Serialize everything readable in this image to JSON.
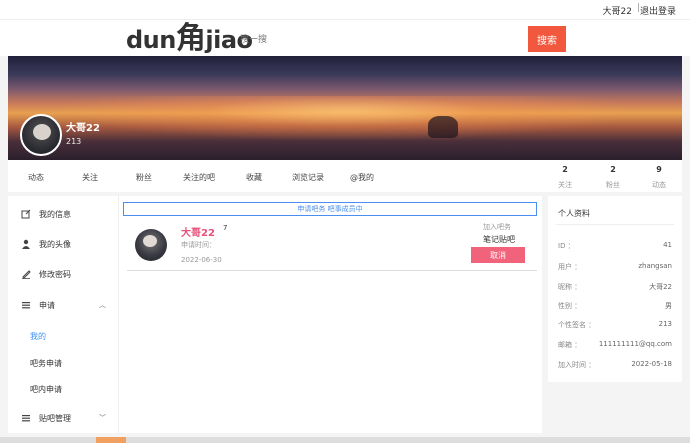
{
  "topbar": {
    "user": "大哥22",
    "separator": "|",
    "logout": "退出登录"
  },
  "header": {
    "logo_pre": "dun",
    "logo_char": "角",
    "logo_post": "jiao",
    "search_placeholder": "搜一搜",
    "search_button": "搜索"
  },
  "banner": {
    "name": "大哥22",
    "number": "213"
  },
  "tabs": [
    "动态",
    "关注",
    "粉丝",
    "关注的吧",
    "收藏",
    "浏览记录",
    "@我的"
  ],
  "stats": [
    {
      "value": "2",
      "label": "关注"
    },
    {
      "value": "2",
      "label": "粉丝"
    },
    {
      "value": "9",
      "label": "动态"
    }
  ],
  "sidebar": {
    "items": [
      {
        "label": "我的信息",
        "icon": "edit-icon"
      },
      {
        "label": "我的头像",
        "icon": "person-icon"
      },
      {
        "label": "修改密码",
        "icon": "pen-icon"
      },
      {
        "label": "申请",
        "icon": "menu-icon"
      }
    ],
    "sub_items": [
      "我的",
      "吧务申请",
      "吧内申请"
    ],
    "last_item": {
      "label": "贴吧管理",
      "icon": "menu-icon"
    }
  },
  "main": {
    "notice": "申请吧务  吧事成员中",
    "card": {
      "name": "大哥22",
      "count": "7",
      "apply_label": "申请时间：",
      "date": "2022-06-30",
      "join_label": "加入吧务",
      "bar_name": "笔记贴吧",
      "cancel": "取消"
    }
  },
  "profile": {
    "title": "个人资料",
    "rows": [
      {
        "key": "ID ：",
        "value": "41"
      },
      {
        "key": "用户 ：",
        "value": "zhangsan"
      },
      {
        "key": "昵称 ：",
        "value": "大哥22"
      },
      {
        "key": "性别 ：",
        "value": "男"
      },
      {
        "key": "个性签名 ：",
        "value": "213"
      },
      {
        "key": "邮箱 ：",
        "value": "111111111@qq.com"
      },
      {
        "key": "加入时间 ：",
        "value": "2022-05-18"
      }
    ]
  }
}
